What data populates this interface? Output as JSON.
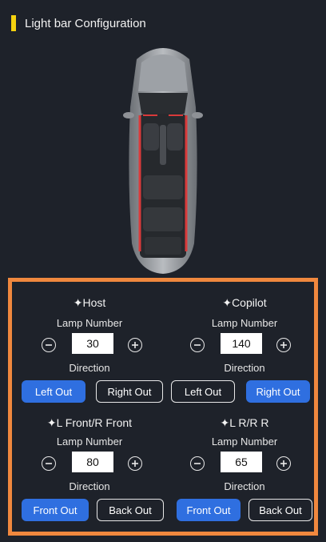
{
  "header": {
    "title": "Light bar Configuration"
  },
  "colors": {
    "accent": "#f5d20f",
    "panel_border": "#f0883e",
    "active_button": "#2f6fe0",
    "background": "#1e222a"
  },
  "icons": {
    "car": "car-top-view-icon",
    "decrease": "minus-circle-icon",
    "increase": "plus-circle-icon"
  },
  "sections": {
    "host": {
      "title": "✦Host",
      "lamp_label": "Lamp Number",
      "value": "30",
      "direction_label": "Direction",
      "left_btn": "Left Out",
      "right_btn": "Right Out",
      "selected": "left"
    },
    "copilot": {
      "title": "✦Copilot",
      "lamp_label": "Lamp Number",
      "value": "140",
      "direction_label": "Direction",
      "left_btn": "Left Out",
      "right_btn": "Right Out",
      "selected": "right"
    },
    "front": {
      "title": "✦L Front/R Front",
      "lamp_label": "Lamp Number",
      "value": "80",
      "direction_label": "Direction",
      "left_btn": "Front Out",
      "right_btn": "Back Out",
      "selected": "left"
    },
    "rear": {
      "title": "✦L R/R R",
      "lamp_label": "Lamp Number",
      "value": "65",
      "direction_label": "Direction",
      "left_btn": "Front Out",
      "right_btn": "Back Out",
      "selected": "left"
    }
  }
}
